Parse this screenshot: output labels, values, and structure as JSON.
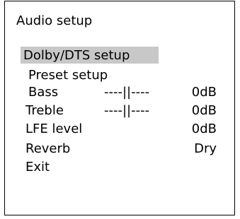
{
  "menu": {
    "title": "Audio setup",
    "items": [
      {
        "label": "Dolby/DTS setup",
        "selected": true
      },
      {
        "label": "Preset setup"
      },
      {
        "label": "Bass",
        "bar": "----||----",
        "value": "0dB"
      },
      {
        "label": "Treble",
        "bar": "----||----",
        "value": "0dB"
      },
      {
        "label": "LFE level",
        "value": "0dB"
      },
      {
        "label": "Reverb",
        "value": "Dry"
      },
      {
        "label": "Exit"
      }
    ]
  },
  "colors": {
    "background": "#ffffff",
    "text": "#000000",
    "border": "#000000",
    "selection": "#c8c8c8"
  }
}
